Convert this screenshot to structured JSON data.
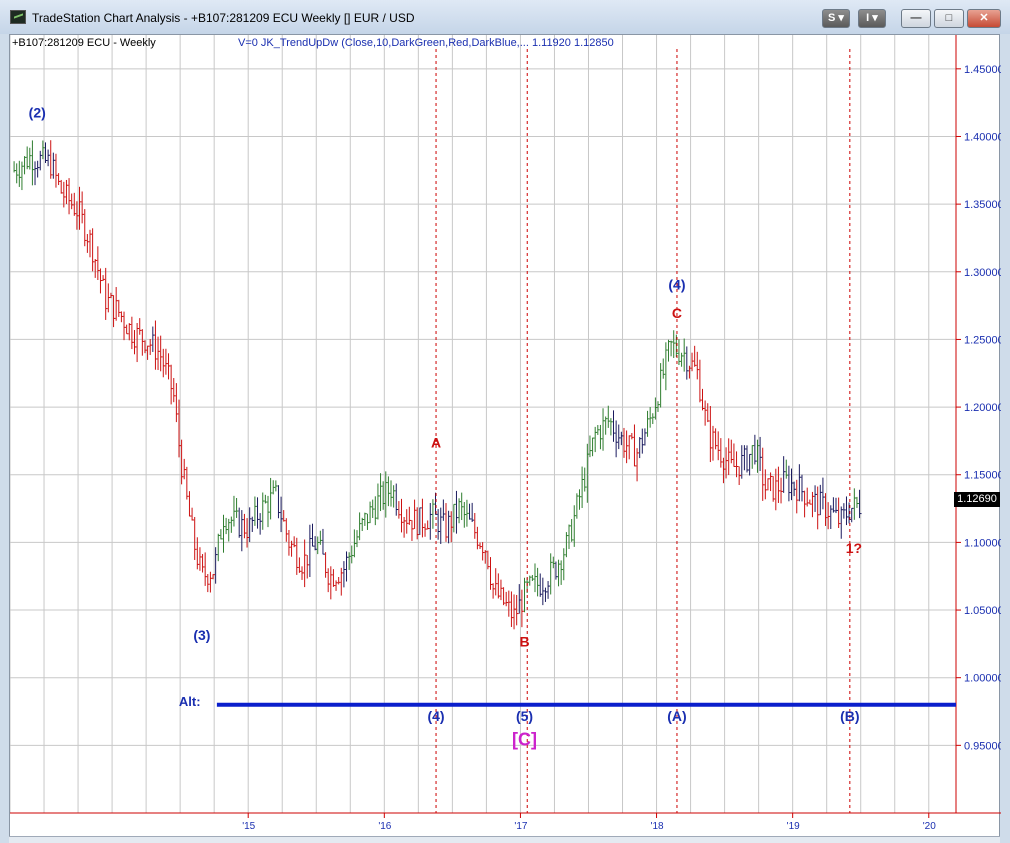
{
  "window": {
    "title": "TradeStation Chart Analysis - +B107:281209 ECU Weekly [] EUR / USD",
    "buttons": {
      "s": "S",
      "i": "I",
      "minimize": "—",
      "maximize": "□",
      "close": "✕"
    }
  },
  "chart_header": {
    "symbol": "+B107:281209 ECU - Weekly",
    "indicator": "V=0  JK_TrendUpDw  (Close,10,DarkGreen,Red,DarkBlue,...   1.11920  1.12850"
  },
  "last_price": "1.12690",
  "colors": {
    "up": "#2e7d2e",
    "down": "#cc1111",
    "neutral": "#1a1a5e",
    "wave_blue": "#1a2fb0",
    "wave_red": "#cc1111",
    "wave_magenta": "#cc22cc",
    "axis_red": "#cc0000",
    "grid": "#c8c8c8"
  },
  "chart_data": {
    "type": "bar",
    "title": "",
    "xlabel": "",
    "ylabel": "",
    "y_axis_side": "right",
    "ylim": [
      0.9,
      1.475
    ],
    "yticks": [
      "1.45000",
      "1.40000",
      "1.35000",
      "1.30000",
      "1.25000",
      "1.20000",
      "1.15000",
      "1.10000",
      "1.05000",
      "1.00000",
      "0.95000"
    ],
    "xticks": [
      {
        "label": "'15",
        "x": 2015.0
      },
      {
        "label": "'16",
        "x": 2016.0
      },
      {
        "label": "'17",
        "x": 2017.0
      },
      {
        "label": "'18",
        "x": 2018.0
      },
      {
        "label": "'19",
        "x": 2019.0
      },
      {
        "label": "'20",
        "x": 2020.0
      }
    ],
    "xlim": [
      2013.25,
      2020.2
    ],
    "grid": true,
    "path": [
      [
        2013.28,
        1.375
      ],
      [
        2013.4,
        1.385
      ],
      [
        2013.55,
        1.38
      ],
      [
        2013.62,
        1.36
      ],
      [
        2013.75,
        1.345
      ],
      [
        2013.85,
        1.32
      ],
      [
        2013.95,
        1.28
      ],
      [
        2014.05,
        1.27
      ],
      [
        2014.15,
        1.255
      ],
      [
        2014.25,
        1.25
      ],
      [
        2014.35,
        1.24
      ],
      [
        2014.45,
        1.21
      ],
      [
        2014.5,
        1.165
      ],
      [
        2014.55,
        1.13
      ],
      [
        2014.6,
        1.1
      ],
      [
        2014.66,
        1.075
      ],
      [
        2014.75,
        1.08
      ],
      [
        2014.82,
        1.12
      ],
      [
        2014.9,
        1.115
      ],
      [
        2015.0,
        1.11
      ],
      [
        2015.1,
        1.125
      ],
      [
        2015.2,
        1.135
      ],
      [
        2015.3,
        1.1
      ],
      [
        2015.4,
        1.085
      ],
      [
        2015.5,
        1.1
      ],
      [
        2015.6,
        1.075
      ],
      [
        2015.7,
        1.08
      ],
      [
        2015.78,
        1.1
      ],
      [
        2015.85,
        1.115
      ],
      [
        2015.95,
        1.13
      ],
      [
        2016.05,
        1.14
      ],
      [
        2016.15,
        1.12
      ],
      [
        2016.25,
        1.115
      ],
      [
        2016.35,
        1.12
      ],
      [
        2016.45,
        1.11
      ],
      [
        2016.55,
        1.125
      ],
      [
        2016.65,
        1.11
      ],
      [
        2016.75,
        1.095
      ],
      [
        2016.8,
        1.065
      ],
      [
        2016.88,
        1.055
      ],
      [
        2016.95,
        1.045
      ],
      [
        2017.05,
        1.065
      ],
      [
        2017.15,
        1.07
      ],
      [
        2017.25,
        1.08
      ],
      [
        2017.35,
        1.1
      ],
      [
        2017.45,
        1.14
      ],
      [
        2017.55,
        1.18
      ],
      [
        2017.65,
        1.19
      ],
      [
        2017.75,
        1.175
      ],
      [
        2017.85,
        1.165
      ],
      [
        2017.95,
        1.19
      ],
      [
        2018.05,
        1.225
      ],
      [
        2018.1,
        1.245
      ],
      [
        2018.2,
        1.24
      ],
      [
        2018.3,
        1.225
      ],
      [
        2018.38,
        1.18
      ],
      [
        2018.45,
        1.17
      ],
      [
        2018.55,
        1.155
      ],
      [
        2018.65,
        1.16
      ],
      [
        2018.72,
        1.17
      ],
      [
        2018.8,
        1.14
      ],
      [
        2018.88,
        1.14
      ],
      [
        2018.95,
        1.145
      ],
      [
        2019.05,
        1.14
      ],
      [
        2019.15,
        1.13
      ],
      [
        2019.25,
        1.125
      ],
      [
        2019.35,
        1.115
      ],
      [
        2019.42,
        1.125
      ],
      [
        2019.5,
        1.128
      ]
    ],
    "alt_line": {
      "label": "Alt:",
      "y": 0.98,
      "x_start": 2014.77,
      "x_end": 2020.2
    },
    "vlines": [
      2016.38,
      2017.05,
      2018.15,
      2019.42
    ],
    "annotations": [
      {
        "text": "(2)",
        "x": 2013.45,
        "y": 1.414,
        "color": "blue"
      },
      {
        "text": "(3)",
        "x": 2014.66,
        "y": 1.028,
        "color": "blue"
      },
      {
        "text": "A",
        "x": 2016.38,
        "y": 1.17,
        "color": "red"
      },
      {
        "text": "B",
        "x": 2017.03,
        "y": 1.023,
        "color": "red"
      },
      {
        "text": "(4)",
        "x": 2018.15,
        "y": 1.287,
        "color": "blue"
      },
      {
        "text": "C",
        "x": 2018.15,
        "y": 1.266,
        "color": "red"
      },
      {
        "text": "1?",
        "x": 2019.45,
        "y": 1.092,
        "color": "red"
      },
      {
        "text": "(4)",
        "x": 2016.38,
        "y": 0.968,
        "color": "blue"
      },
      {
        "text": "(5)",
        "x": 2017.03,
        "y": 0.968,
        "color": "blue"
      },
      {
        "text": "[C]",
        "x": 2017.03,
        "y": 0.95,
        "color": "magenta"
      },
      {
        "text": "(A)",
        "x": 2018.15,
        "y": 0.968,
        "color": "blue"
      },
      {
        "text": "(B)",
        "x": 2019.42,
        "y": 0.968,
        "color": "blue"
      }
    ]
  }
}
